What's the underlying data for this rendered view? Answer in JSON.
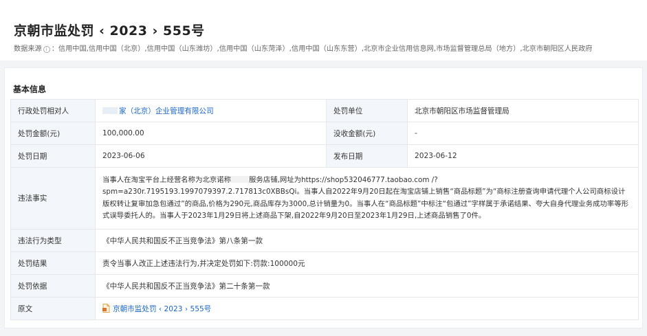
{
  "header": {
    "title": "京朝市监处罚 ‹ 2023 › 555号",
    "source_label": "数据来源",
    "source_text": "：信用中国,信用中国（北京）,信用中国（山东潍坊）,信用中国（山东菏泽）,信用中国（山东东营）,北京市企业信用信息网,市场监督管理总局（地方）,北京市朝阳区人民政府"
  },
  "section": {
    "title": "基本信息"
  },
  "table": {
    "party_label": "行政处罚相对人",
    "party_value": "家（北京）企业管理有限公司",
    "unit_label": "处罚单位",
    "unit_value": "北京市朝阳区市场监督管理局",
    "amount_label": "处罚金额(元)",
    "amount_value": "100,000.00",
    "confiscate_label": "没收金额(元)",
    "confiscate_value": "-",
    "date_label": "处罚日期",
    "date_value": "2023-06-06",
    "publish_label": "发布日期",
    "publish_value": "2023-06-12",
    "facts_label": "违法事实",
    "facts_part1": "当事人在淘宝平台上经营名称为北京诺称",
    "facts_part2": "服务店铺,网址为https://shop532046777.taobao.com /?spm=a230r.7195193.1997079397.2.717813c0XBBsQi。当事人自2022年9月20日起在淘宝店铺上销售“商品标题”为“商标注册查询申请代理个人公司商标设计版权转让复审加急包通过”的商品,价格为290元,商品库存为3000,总计销量为0。当事人在“商品标题”中标注“包通过”字样属于承诺结果、夸大自身代理业务成功率等形式误导委托人的。当事人于2023年1月29日将上述商品下架,自2022年9月20日至2023年1月29日,上述商品销售了0件。",
    "type_label": "违法行为类型",
    "type_value": "《中华人民共和国反不正当竞争法》第八条第一款",
    "result_label": "处罚结果",
    "result_value": "责令当事人改正上述违法行为,并决定处罚如下:罚款:100000元",
    "basis_label": "处罚依据",
    "basis_value": "《中华人民共和国反不正当竞争法》第二十条第一款",
    "original_label": "原文",
    "original_link": "京朝市监处罚 ‹ 2023 › 555号"
  },
  "colors": {
    "link": "#1a66c9",
    "label_bg": "#f3f6fa",
    "border": "#e5e7eb"
  },
  "icons": [
    "info-icon",
    "document-icon"
  ]
}
